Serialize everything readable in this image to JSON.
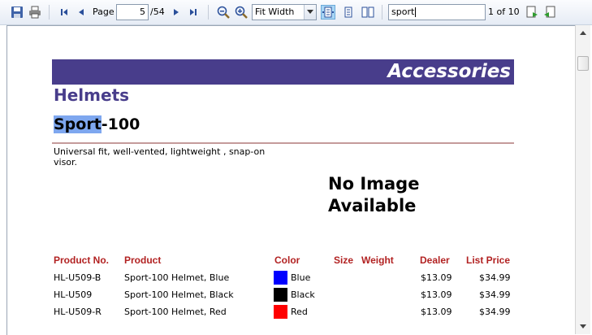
{
  "toolbar": {
    "page_label": "Page",
    "page_value": "5",
    "page_total": "/54",
    "zoom_value": "Fit Width",
    "search_value": "sport",
    "search_result": "1 of 10"
  },
  "report": {
    "section": "Accessories",
    "category": "Helmets",
    "product_highlight": "Sport",
    "product_rest": "-100",
    "description": "Universal fit, well-vented, lightweight , snap-on visor.",
    "image_line1": "No Image",
    "image_line2": "Available",
    "headers": {
      "product_no": "Product No.",
      "product": "Product",
      "color": "Color",
      "size": "Size",
      "weight": "Weight",
      "dealer": "Dealer",
      "list_price": "List Price"
    },
    "rows": [
      {
        "product_no": "HL-U509-B",
        "product": "Sport-100 Helmet, Blue",
        "color": "Blue",
        "swatch": "#0000ff",
        "dealer": "$13.09",
        "list_price": "$34.99"
      },
      {
        "product_no": "HL-U509",
        "product": "Sport-100 Helmet, Black",
        "color": "Black",
        "swatch": "#000000",
        "dealer": "$13.09",
        "list_price": "$34.99"
      },
      {
        "product_no": "HL-U509-R",
        "product": "Sport-100 Helmet, Red",
        "color": "Red",
        "swatch": "#ff0000",
        "dealer": "$13.09",
        "list_price": "$34.99"
      }
    ]
  },
  "colors": {
    "band": "#483d8b",
    "header_text": "#b22222",
    "highlight": "#7ea7ef"
  },
  "icons": [
    "save-icon",
    "print-icon",
    "first-page-icon",
    "prev-page-icon",
    "next-page-icon",
    "last-page-icon",
    "zoom-out-icon",
    "zoom-in-icon",
    "chevron-down-icon",
    "page-layout-icon",
    "single-page-icon",
    "two-page-icon",
    "find-next-icon",
    "find-prev-icon",
    "scroll-up-icon",
    "scroll-down-icon"
  ]
}
